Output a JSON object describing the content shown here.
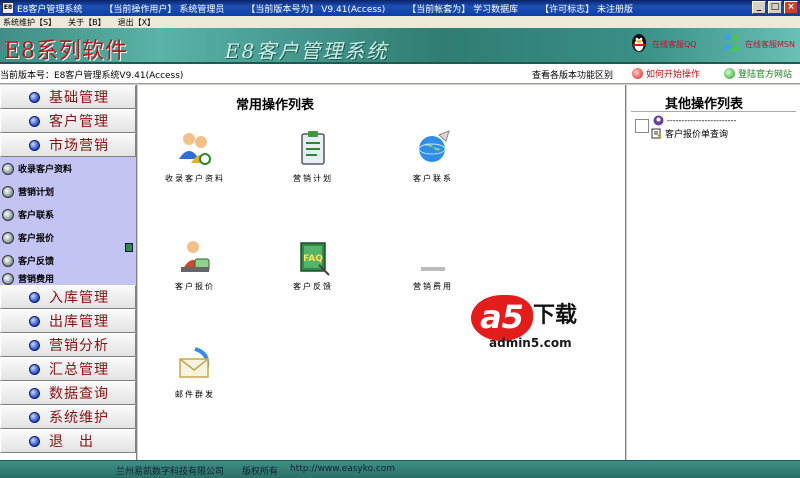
{
  "window": {
    "icon_text": "E8",
    "app_name": "E8客户管理系统",
    "operator_label": "【当前操作用户】",
    "operator_value": "系统管理员",
    "version_label": "【当前版本号为】",
    "version_value": "V9.41(Access)",
    "account_label": "【当前帐套为】",
    "account_value": "学习数据库",
    "license_label": "【许可标志】",
    "license_value": "未注册版",
    "btn_min": "_",
    "btn_max": "□",
    "btn_close": "×"
  },
  "menu": {
    "items": [
      "系统维护【S】",
      "关于【B】",
      "退出【X】"
    ]
  },
  "banner": {
    "logo": "E8系列软件",
    "system_title": "E8客户管理系统",
    "link1": "在线客服QQ",
    "link2": "在线客服MSN"
  },
  "version_bar": {
    "text": "当前版本号：E8客户管理系统V9.41(Access)",
    "diff": "查看各版本功能区别",
    "howto": "如何开始操作",
    "website": "登陆官方网站"
  },
  "nav": {
    "top": [
      {
        "label": "基础管理"
      },
      {
        "label": "客户管理"
      },
      {
        "label": "市场营销"
      }
    ],
    "sub": [
      {
        "label": "收录客户资料"
      },
      {
        "label": "营销计划"
      },
      {
        "label": "客户联系"
      },
      {
        "label": "客户报价"
      },
      {
        "label": "客户反馈"
      },
      {
        "label": "营销费用"
      }
    ],
    "bottom": [
      {
        "label": "入库管理"
      },
      {
        "label": "出库管理"
      },
      {
        "label": "营销分析"
      },
      {
        "label": "汇总管理"
      },
      {
        "label": "数据查询"
      },
      {
        "label": "系统维护"
      },
      {
        "label": "退　出"
      }
    ]
  },
  "center": {
    "heading": "常用操作列表",
    "ops": [
      {
        "label": "收录客户资料",
        "icon": "users-icon"
      },
      {
        "label": "营销计划",
        "icon": "clipboard-icon"
      },
      {
        "label": "客户联系",
        "icon": "globe-icon"
      },
      {
        "label": "客户报价",
        "icon": "person-quote-icon"
      },
      {
        "label": "客户反馈",
        "icon": "faq-book-icon"
      },
      {
        "label": "营销费用",
        "icon": "cost-icon"
      },
      {
        "label": "邮件群发",
        "icon": "mail-icon"
      }
    ]
  },
  "right": {
    "heading": "其他操作列表",
    "tree_root": "------------------------",
    "tree_item": "客户报价单查询"
  },
  "watermark": {
    "brand": "a5",
    "download": "下载",
    "site": "admin5.com"
  },
  "footer": {
    "company": "兰州易凯数字科技有限公司",
    "copyright": "版权所有",
    "url": "http://www.easyko.com"
  },
  "colors": {
    "banner_teal": "#3f8f86",
    "nav_text": "#8a1010",
    "sub_panel": "#c3c3f4",
    "watermark_red": "#e31c1c"
  }
}
